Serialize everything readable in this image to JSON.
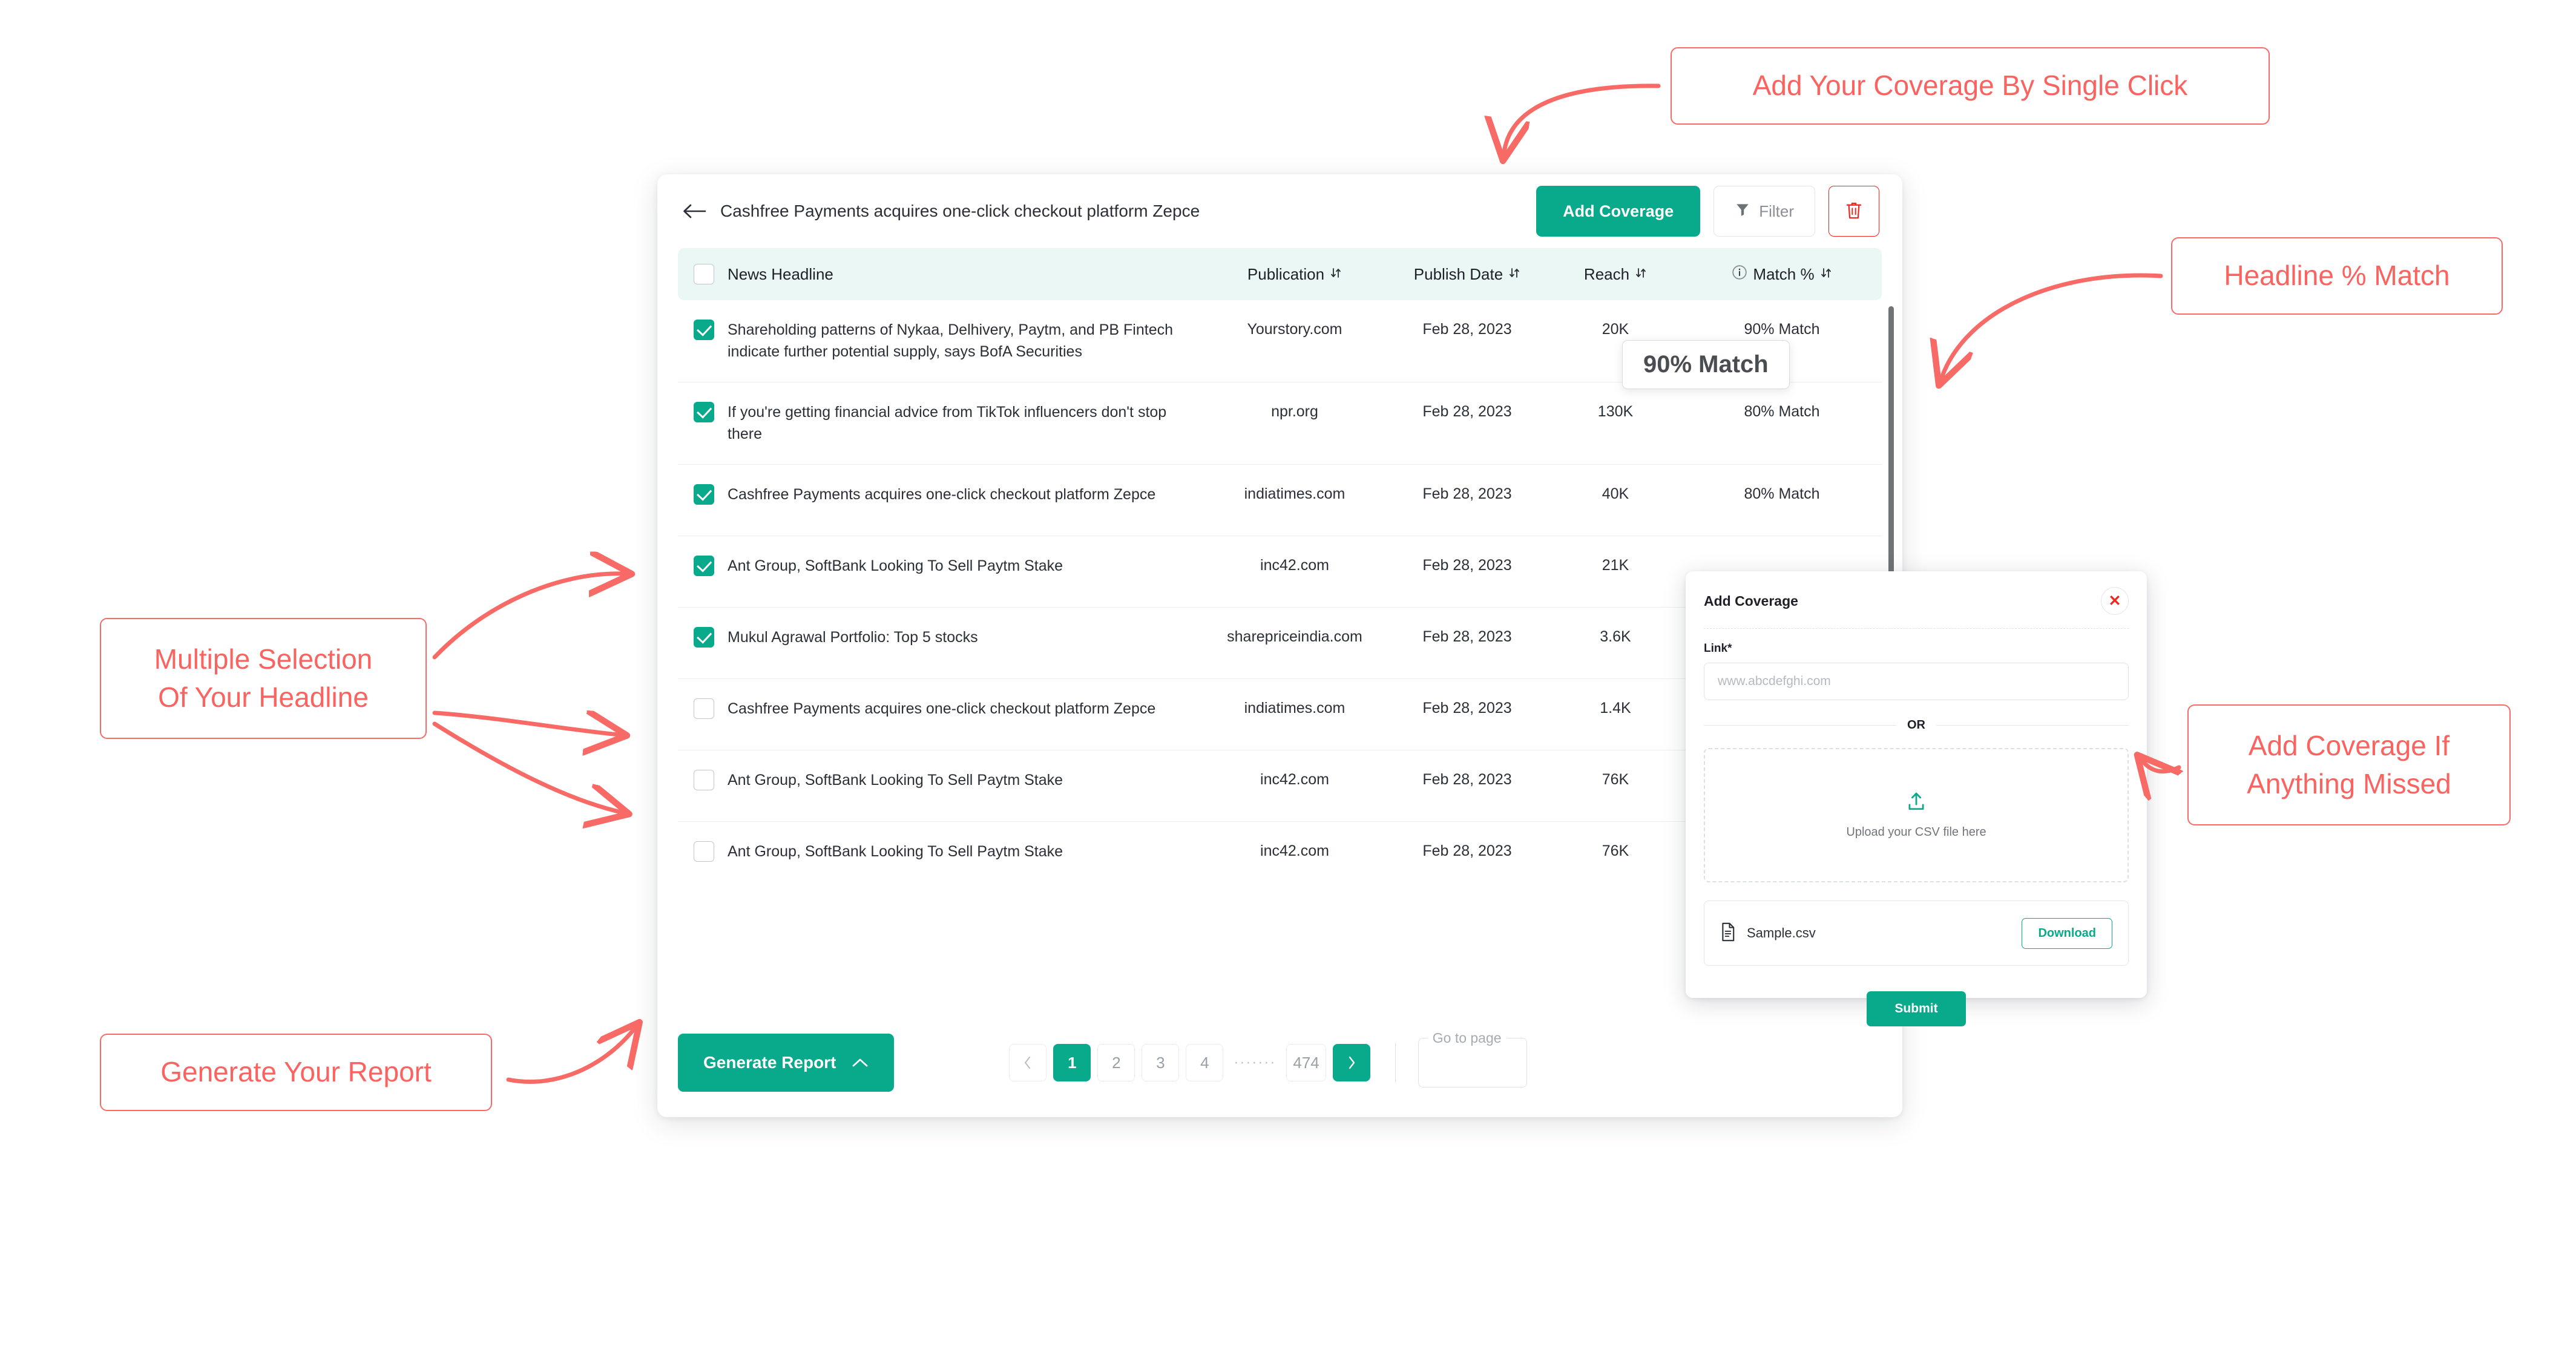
{
  "app": {
    "page_title": "Cashfree Payments acquires one-click checkout platform Zepce",
    "back_icon": "arrow-left-icon",
    "toolbar": {
      "add_coverage_label": "Add Coverage",
      "filter_label": "Filter",
      "filter_icon": "funnel-icon",
      "delete_icon": "trash-icon"
    },
    "table": {
      "columns": [
        {
          "label": "News Headline",
          "sortable": false
        },
        {
          "label": "Publication",
          "sortable": true
        },
        {
          "label": "Publish Date",
          "sortable": true
        },
        {
          "label": "Reach",
          "sortable": true
        },
        {
          "label": "Match %",
          "sortable": true,
          "info_icon": "info-circle-icon"
        }
      ],
      "rows": [
        {
          "checked": true,
          "headline": "Shareholding patterns of Nykaa, Delhivery, Paytm, and PB Fintech indicate further potential supply, says BofA Securities",
          "publication": "Yourstory.com",
          "publish_date": "Feb 28, 2023",
          "reach": "20K",
          "match": "90% Match"
        },
        {
          "checked": true,
          "headline": "If you're getting financial advice from TikTok influencers don't stop there",
          "publication": "npr.org",
          "publish_date": "Feb 28, 2023",
          "reach": "130K",
          "match": "80% Match"
        },
        {
          "checked": true,
          "headline": "Cashfree Payments acquires one-click checkout platform Zepce",
          "publication": "indiatimes.com",
          "publish_date": "Feb 28, 2023",
          "reach": "40K",
          "match": "80% Match"
        },
        {
          "checked": true,
          "headline": "Ant Group, SoftBank Looking To Sell Paytm Stake",
          "publication": "inc42.com",
          "publish_date": "Feb 28, 2023",
          "reach": "21K",
          "match": ""
        },
        {
          "checked": true,
          "headline": "Mukul Agrawal Portfolio: Top 5 stocks",
          "publication": "sharepriceindia.com",
          "publish_date": "Feb 28, 2023",
          "reach": "3.6K",
          "match": ""
        },
        {
          "checked": false,
          "headline": "Cashfree Payments acquires one-click checkout platform Zepce",
          "publication": "indiatimes.com",
          "publish_date": "Feb 28, 2023",
          "reach": "1.4K",
          "match": ""
        },
        {
          "checked": false,
          "headline": "Ant Group, SoftBank Looking To Sell Paytm Stake",
          "publication": "inc42.com",
          "publish_date": "Feb 28, 2023",
          "reach": "76K",
          "match": ""
        },
        {
          "checked": false,
          "headline": "Ant Group, SoftBank Looking To Sell Paytm Stake",
          "publication": "inc42.com",
          "publish_date": "Feb 28, 2023",
          "reach": "76K",
          "match": ""
        }
      ],
      "match_tooltip": "90% Match"
    },
    "footer": {
      "generate_report_label": "Generate Report",
      "generate_report_chevron": "chevron-up-icon",
      "pagination": {
        "prev_icon": "chevron-left-icon",
        "next_icon": "chevron-right-icon",
        "pages": [
          "1",
          "2",
          "3",
          "4"
        ],
        "ellipsis": "·······",
        "last_page": "474",
        "current_page": "1"
      },
      "goto_page_label": "Go to page",
      "goto_page_value": ""
    }
  },
  "modal": {
    "title": "Add Coverage",
    "close_icon": "close-x-icon",
    "link_label": "Link*",
    "link_placeholder": "www.abcdefghi.com",
    "link_value": "",
    "or_label": "OR",
    "upload_icon": "upload-icon",
    "upload_label": "Upload your CSV file here",
    "sample_file_icon": "file-icon",
    "sample_file_name": "Sample.csv",
    "download_label": "Download",
    "submit_label": "Submit"
  },
  "annotations": {
    "add_coverage": "Add Your Coverage By Single Click",
    "headline_match": "Headline % Match",
    "multi_select_line1": "Multiple Selection",
    "multi_select_line2": "Of Your Headline",
    "add_if_missed_line1": "Add Coverage If",
    "add_if_missed_line2": "Anything Missed",
    "generate_report": "Generate Your Report"
  },
  "colors": {
    "accent": "#09a98b",
    "annotation": "#f96360",
    "danger": "#f2251f",
    "header_bg": "#ebf7f4"
  }
}
